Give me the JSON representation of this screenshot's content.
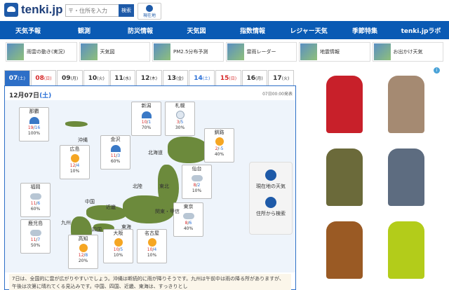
{
  "header": {
    "logo_text": "tenki.jp",
    "search_placeholder": "〒・住所を入力",
    "search_button": "検索",
    "location_button": "現在地"
  },
  "nav": [
    "天気予報",
    "観測",
    "防災情報",
    "天気図",
    "指数情報",
    "レジャー天気",
    "季節特集",
    "tenki.jpラボ"
  ],
  "subnav": [
    "雨雲の動き(実況)",
    "天気図",
    "PM2.5分布予測",
    "雷雨レーダー",
    "地震情報",
    "お出かけ天気"
  ],
  "tabs": [
    {
      "label": "07",
      "dow": "(土)",
      "type": "sat",
      "active": true
    },
    {
      "label": "08",
      "dow": "(日)",
      "type": "sun"
    },
    {
      "label": "09",
      "dow": "(月)",
      "type": "wd"
    },
    {
      "label": "10",
      "dow": "(火)",
      "type": "wd"
    },
    {
      "label": "11",
      "dow": "(水)",
      "type": "wd"
    },
    {
      "label": "12",
      "dow": "(木)",
      "type": "wd"
    },
    {
      "label": "13",
      "dow": "(金)",
      "type": "wd"
    },
    {
      "label": "14",
      "dow": "(土)",
      "type": "sat"
    },
    {
      "label": "15",
      "dow": "(日)",
      "type": "sun"
    },
    {
      "label": "16",
      "dow": "(月)",
      "type": "wd"
    },
    {
      "label": "17",
      "dow": "(火)",
      "type": "wd"
    }
  ],
  "panel": {
    "date_main": "12月07日",
    "date_dow": "(土)",
    "published": "07日00:00発表"
  },
  "cities": [
    {
      "name": "那覇",
      "hi": "19",
      "lo": "16",
      "pop": "100%",
      "icon": "rain"
    },
    {
      "name": "新潟",
      "hi": "10",
      "lo": "1",
      "pop": "70%",
      "icon": "rain"
    },
    {
      "name": "札幌",
      "hi": "3",
      "lo": "5",
      "pop": "30%",
      "icon": "snow"
    },
    {
      "name": "釧路",
      "hi": "2",
      "lo": "-5",
      "pop": "40%",
      "icon": "sun"
    },
    {
      "name": "金沢",
      "hi": "11",
      "lo": "3",
      "pop": "60%",
      "icon": "rain"
    },
    {
      "name": "広島",
      "hi": "12",
      "lo": "4",
      "pop": "10%",
      "icon": "sun"
    },
    {
      "name": "仙台",
      "hi": "8",
      "lo": "2",
      "pop": "10%",
      "icon": "cloud"
    },
    {
      "name": "福岡",
      "hi": "11",
      "lo": "6",
      "pop": "60%",
      "icon": "cloud"
    },
    {
      "name": "東京",
      "hi": "8",
      "lo": "6",
      "pop": "40%",
      "icon": "cloud"
    },
    {
      "name": "鹿児島",
      "hi": "11",
      "lo": "7",
      "pop": "50%",
      "icon": "cloud"
    },
    {
      "name": "大阪",
      "hi": "10",
      "lo": "5",
      "pop": "10%",
      "icon": "sun"
    },
    {
      "name": "名古屋",
      "hi": "10",
      "lo": "4",
      "pop": "10%",
      "icon": "sun"
    },
    {
      "name": "高知",
      "hi": "12",
      "lo": "8",
      "pop": "20%",
      "icon": "sun"
    }
  ],
  "map_labels": [
    "沖縄",
    "北海道",
    "東北",
    "北陸",
    "関東・甲信",
    "近畿",
    "中国",
    "九州",
    "四国",
    "東海"
  ],
  "side_buttons": [
    "現在地の天気",
    "住所から検索"
  ],
  "forecast_text": "7日は、全国的に雲が広がりやすいでしょう。沖縄は断続的に雨が降りそうです。九州は午前中は雨の降る所がありますが、午後は次第に晴れてくる見込みです。中国、四国、近畿、東海は、すっきりとし",
  "ad": {
    "badge": "i",
    "jacket_colors": [
      "#c8202a",
      "#a58a72",
      "#6b6a3a",
      "#5d6c80",
      "#9a5a24",
      "#b3cc1a"
    ]
  }
}
